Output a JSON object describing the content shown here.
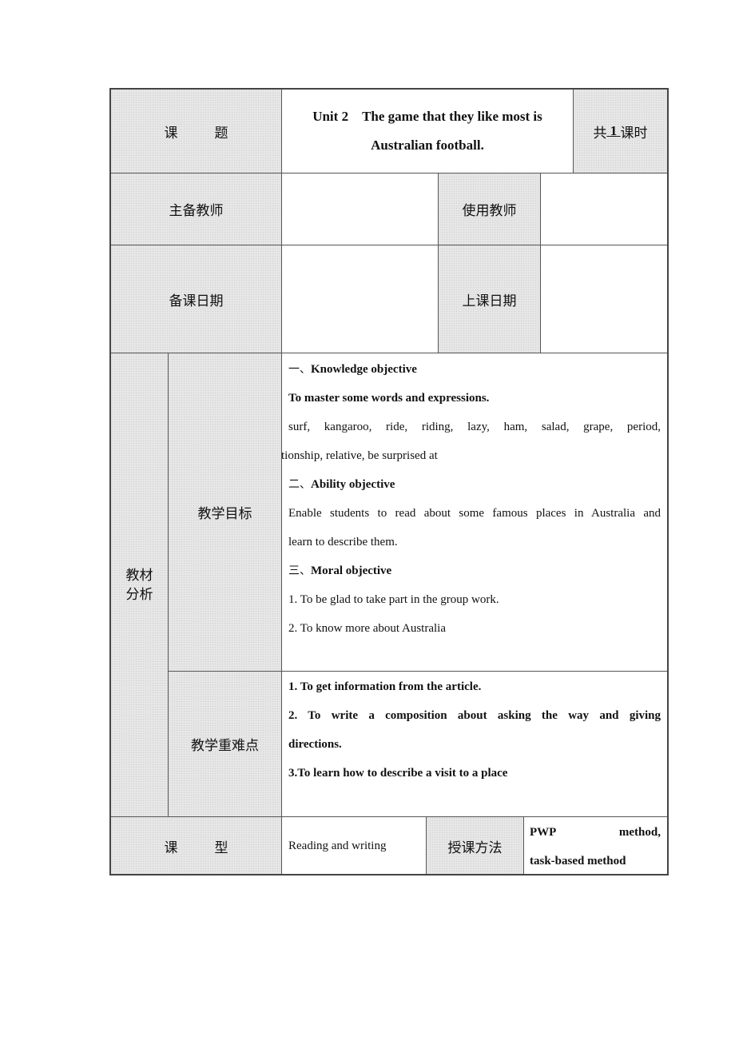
{
  "row1": {
    "label": "课 题",
    "label_chars": [
      "课",
      "题"
    ],
    "title_line1": "Unit 2    The game that they like most is",
    "title_line2": "Australian football.",
    "periods_prefix": "共",
    "periods_value": "1",
    "periods_suffix": "课时"
  },
  "row2": {
    "main_teacher_label": "主备教师",
    "main_teacher_value": "",
    "using_teacher_label": "使用教师",
    "using_teacher_value": ""
  },
  "row3": {
    "prep_date_label": "备课日期",
    "prep_date_value": "",
    "class_date_label": "上课日期",
    "class_date_value": ""
  },
  "analysis": {
    "label_line1": "教材",
    "label_line2": "分析",
    "objectives": {
      "label": "教学目标",
      "knowledge_heading_num": "一、",
      "knowledge_heading": "Knowledge objective",
      "knowledge_intro": "To master some words and expressions.",
      "words_line1": "surf, kangaroo, ride, riding, lazy, ham, salad, grape, period,",
      "words_line2": "tionship, relative, be surprised at",
      "ability_heading_num": "二、",
      "ability_heading": "Ability objective",
      "ability_line1": "Enable students to read about some famous places in Australia and",
      "ability_line2": "learn to describe them.",
      "moral_heading_num": "三、",
      "moral_heading": "Moral objective",
      "moral_items": [
        "1. To be glad to take part in the group work.",
        "2. To know more about Australia"
      ]
    },
    "key_points": {
      "label": "教学重难点",
      "item1": "1. To get information from the article.",
      "item2_line1": "2. To write a composition about asking the way and giving",
      "item2_line2": "directions.",
      "item3": "3.To learn how to describe a visit to a place"
    }
  },
  "last_row": {
    "type_label_chars": [
      "课",
      "型"
    ],
    "type_value": "Reading and writing",
    "method_label": "授课方法",
    "method_line1_left": "PWP",
    "method_line1_right": "method,",
    "method_line2": "task-based method"
  }
}
